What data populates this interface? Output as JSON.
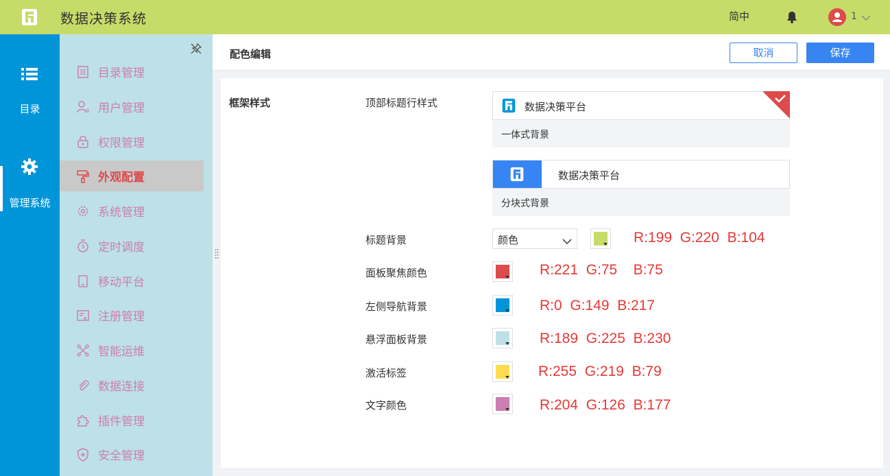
{
  "app": {
    "title": "数据决策系统",
    "language": "简中",
    "user": "1"
  },
  "leftnav": [
    {
      "label": "目录",
      "icon": "list-icon"
    },
    {
      "label": "管理系统",
      "icon": "gear-icon"
    }
  ],
  "subnav": [
    {
      "label": "目录管理",
      "icon": "catalog-icon"
    },
    {
      "label": "用户管理",
      "icon": "user-icon"
    },
    {
      "label": "权限管理",
      "icon": "lock-icon"
    },
    {
      "label": "外观配置",
      "icon": "paint-roller-icon"
    },
    {
      "label": "系统管理",
      "icon": "gear-icon"
    },
    {
      "label": "定时调度",
      "icon": "timer-icon"
    },
    {
      "label": "移动平台",
      "icon": "tablet-icon"
    },
    {
      "label": "注册管理",
      "icon": "register-icon"
    },
    {
      "label": "智能运维",
      "icon": "ops-icon"
    },
    {
      "label": "数据连接",
      "icon": "paperclip-icon"
    },
    {
      "label": "插件管理",
      "icon": "puzzle-icon"
    },
    {
      "label": "安全管理",
      "icon": "shield-icon"
    }
  ],
  "active_subnav": "外观配置",
  "header": {
    "title": "配色编辑",
    "cancel": "取消",
    "save": "保存"
  },
  "form": {
    "section_title": "框架样式",
    "top_style_label": "顶部标题行样式",
    "cards": [
      {
        "title": "数据决策平台",
        "caption": "一体式背景",
        "selected": true
      },
      {
        "title": "数据决策平台",
        "caption": "分块式背景",
        "selected": false
      }
    ],
    "rows": [
      {
        "label": "标题背景",
        "select": "颜色",
        "color": "#c7dc68",
        "rgb": "R:199  G:220  B:104"
      },
      {
        "label": "面板聚焦颜色",
        "color": "#dd4b4b",
        "rgb": "R:221  G:75    B:75"
      },
      {
        "label": "左侧导航背景",
        "color": "#0095d9",
        "rgb": "R:0  G:149  B:217"
      },
      {
        "label": "悬浮面板背景",
        "color": "#bde1e6",
        "rgb": "R:189  G:225  B:230"
      },
      {
        "label": "激活标签",
        "color": "#ffdb4f",
        "rgb": "R:255  G:219  B:79"
      },
      {
        "label": "文字颜色",
        "color": "#cc7eb1",
        "rgb": "R:204  G:126  B:177"
      }
    ]
  },
  "colors": {
    "accent": "#3685f2",
    "topbar": "#c7dc68",
    "leftnav": "#0095d9",
    "subnav": "#bde1e6",
    "active_text": "#dd4b4b",
    "subnav_text": "#cc7eb1"
  }
}
